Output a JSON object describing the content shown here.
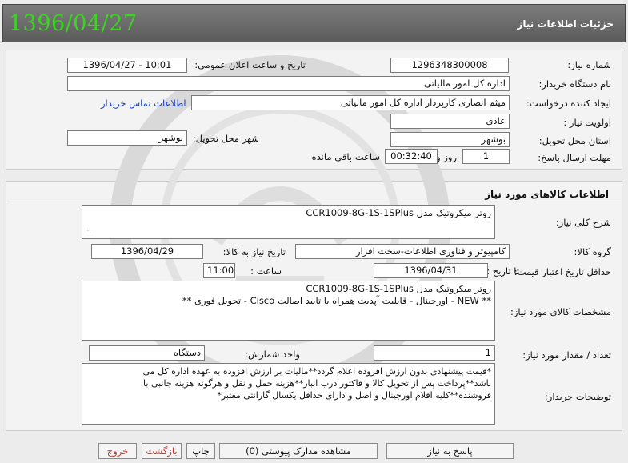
{
  "header": {
    "date": "1396/04/27",
    "title": "جزئیات اطلاعات نیاز"
  },
  "need": {
    "number_label": "شماره نیاز:",
    "number": "1296348300008",
    "announce_label": "تاریخ و ساعت اعلان عمومی:",
    "announce_value": "1396/04/27 - 10:01",
    "buyer_label": "نام دستگاه خریدار:",
    "buyer": "اداره کل امور مالیاتی",
    "creator_label": "ایجاد کننده درخواست:",
    "creator": "میثم انصاری کارپرداز اداره کل امور مالیاتی",
    "contact_link": "اطلاعات تماس خریدار",
    "priority_label": "اولویت نیاز :",
    "priority": "عادی",
    "province_label": "استان محل تحویل:",
    "province": "بوشهر",
    "city_label": "شهر محل تحویل:",
    "city": "بوشهر",
    "deadline_label": "مهلت ارسال پاسخ:",
    "days": "1",
    "days_unit": "روز و",
    "time": "00:32:40",
    "remaining_label": "ساعت باقی مانده"
  },
  "goods": {
    "section_title": "اطلاعات کالاهای مورد نیاز",
    "desc_label": "شرح کلی نیاز:",
    "desc": "روتر میکروتیک مدل CCR1009-8G-1S-1SPlus",
    "group_label": "گروه کالا:",
    "group": "کامپیوتر و فناوری اطلاعات-سخت افزار",
    "need_date_label": "تاریخ نیاز به کالا:",
    "need_date": "1396/04/29",
    "validity_label": "حداقل تاریخ اعتبار قیمت:",
    "until_label": "تا تاریخ :",
    "until_date": "1396/04/31",
    "hour_label": "ساعت :",
    "hour": "11:00",
    "spec_label": "مشخصات کالای مورد نیاز:",
    "spec_line1": "روتر میکروتیک مدل CCR1009-8G-1S-1SPlus",
    "spec_line2": "** NEW - اورجینال - قابلیت آپدیت همراه با تایید اصالت Cisco - تحویل فوری **",
    "qty_label": "تعداد / مقدار مورد نیاز:",
    "qty": "1",
    "unit_label": "واحد شمارش:",
    "unit": "دستگاه",
    "notes_label": "توضیحات خریدار:",
    "notes_1": "*قیمت پیشنهادی بدون ارزش افزوده اعلام گردد**مالیات بر ارزش افزوده به عهده اداره کل می",
    "notes_2": "باشد**پرداخت پس از تحویل کالا و فاکتور درب انبار**هزینه حمل و نقل و هرگونه هزینه جانبی با",
    "notes_3": "فروشنده**کلیه اقلام اورجینال و اصل و دارای حداقل یکسال گارانتی معتبر*"
  },
  "buttons": {
    "reply": "پاسخ به نیاز",
    "attachments": "مشاهده مدارک پیوستی (0)",
    "print": "چاپ",
    "back": "بازگشت",
    "exit": "خروج"
  },
  "colors": {
    "header_date": "#39d61f",
    "link": "#2140b8",
    "back_button_text": "#c0392b"
  }
}
